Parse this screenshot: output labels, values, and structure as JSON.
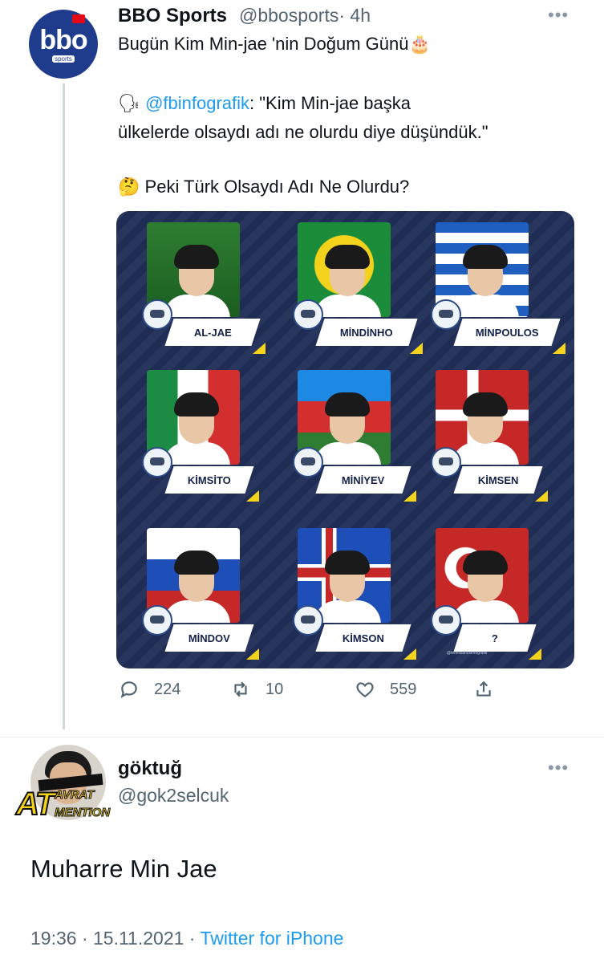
{
  "tweet": {
    "author_name": "BBO Sports",
    "author_handle": "@bbosports",
    "time": "· 4h",
    "avatar_logo": "bbo",
    "avatar_sub": "sports",
    "title_line": "Bugün Kim Min-jae 'nin Doğum Günü🎂",
    "quote_icon": "🗣",
    "quote_mention": "@fbinfografik",
    "quote_text_1": ": \"Kim Min-jae başka",
    "quote_text_2": "ülkelerde olsaydı adı ne olurdu diye düşündük.\"",
    "question_icon": "🤔",
    "question_text": "Peki Türk Olsaydı Adı Ne Olurdu?",
    "more_icon": "more-dots-icon",
    "image": {
      "panels": [
        {
          "name": "AL-JAE",
          "flag": "saudi-arabia"
        },
        {
          "name": "MİNDİNHO",
          "flag": "brazil"
        },
        {
          "name": "MİNPOULOS",
          "flag": "greece"
        },
        {
          "name": "KİMSİTO",
          "flag": "italy"
        },
        {
          "name": "MİNİYEV",
          "flag": "azerbaijan"
        },
        {
          "name": "KİMSEN",
          "flag": "denmark"
        },
        {
          "name": "MİNDOV",
          "flag": "russia"
        },
        {
          "name": "KİMSON",
          "flag": "iceland"
        },
        {
          "name": "?",
          "flag": "turkey"
        }
      ],
      "watermark": "@fenerbahceinfografik"
    },
    "actions": {
      "replies": "224",
      "retweets": "10",
      "likes": "559"
    }
  },
  "reply": {
    "author_name": "göktuğ",
    "author_handle": "@gok2selcuk",
    "avatar_badge_big": "AT",
    "avatar_badge_top": "AVRAT",
    "avatar_badge_bottom": "MENTION",
    "text": "Muharre Min Jae",
    "timestamp": "19:36 · 15.11.2021 · ",
    "source": "Twitter for iPhone",
    "more_icon": "more-dots-icon"
  },
  "colors": {
    "link": "#1d9bf0",
    "muted": "#536471",
    "card_bg": "#1f2d55",
    "accent_yellow": "#f5d21c"
  }
}
